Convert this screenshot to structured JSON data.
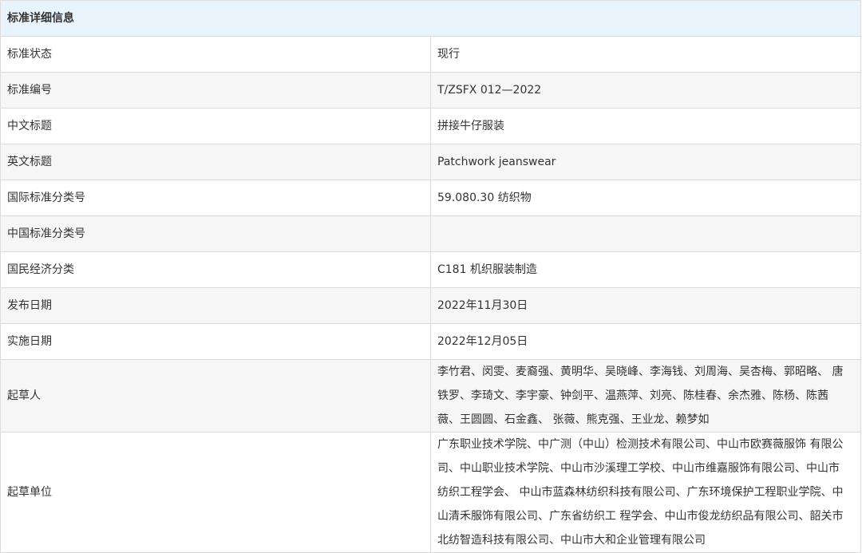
{
  "section": {
    "title": "标准详细信息"
  },
  "rows": [
    {
      "label": "标准状态",
      "value": "现行"
    },
    {
      "label": "标准编号",
      "value": "T/ZSFX 012—2022"
    },
    {
      "label": "中文标题",
      "value": "拼接牛仔服装"
    },
    {
      "label": "英文标题",
      "value": "Patchwork jeanswear"
    },
    {
      "label": "国际标准分类号",
      "value": "59.080.30 纺织物"
    },
    {
      "label": "中国标准分类号",
      "value": ""
    },
    {
      "label": "国民经济分类",
      "value": "C181 机织服装制造"
    },
    {
      "label": "发布日期",
      "value": "2022年11月30日"
    },
    {
      "label": "实施日期",
      "value": "2022年12月05日"
    },
    {
      "label": "起草人",
      "value": "李竹君、闵雯、麦裔强、黄明华、吴晓峰、李海钱、刘周海、吴杏梅、郭昭略、 唐铁罗、李琦文、李宇豪、钟剑平、温燕萍、刘亮、陈桂春、余杰雅、陈杨、陈茜薇、王圆圆、石金鑫、 张薇、熊克强、王业龙、赖梦如"
    },
    {
      "label": "起草单位",
      "value": "广东职业技术学院、中广测（中山）检测技术有限公司、中山市欧赛薇服饰 有限公司、中山职业技术学院、中山市沙溪理工学校、中山市维嘉服饰有限公司、中山市纺织工程学会、 中山市蓝森林纺织科技有限公司、广东环境保护工程职业学院、中山清禾服饰有限公司、广东省纺织工 程学会、中山市俊龙纺织品有限公司、韶关市北纺智造科技有限公司、中山市大和企业管理有限公司"
    }
  ]
}
